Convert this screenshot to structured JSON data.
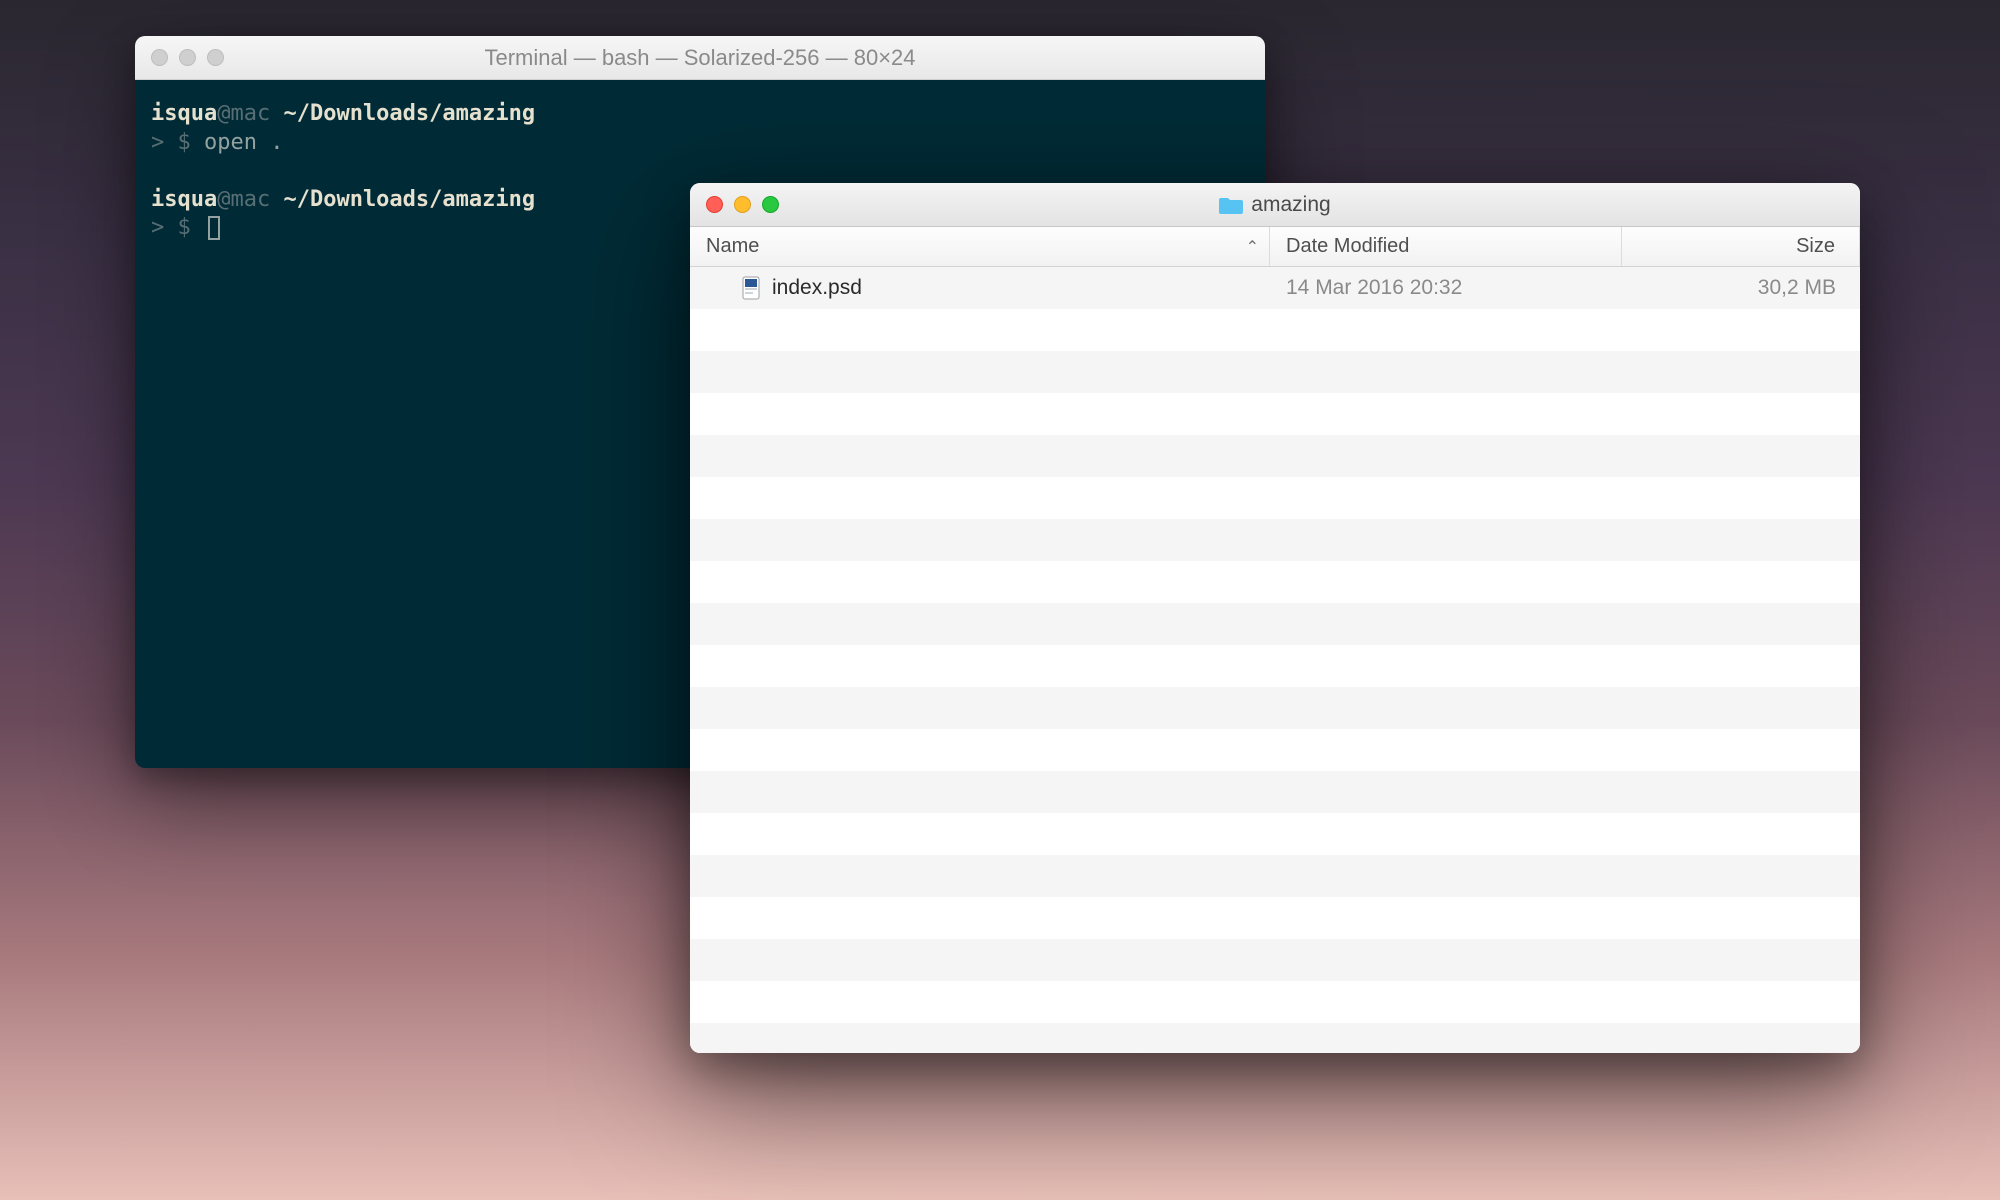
{
  "terminal": {
    "title": "Terminal — bash — Solarized-256 — 80×24",
    "lines": [
      {
        "user": "isqua",
        "at": "@",
        "host": "mac ",
        "path": "~/Downloads/amazing"
      },
      {
        "prompt": "> $ ",
        "cmd": "open ."
      }
    ],
    "lines2": [
      {
        "user": "isqua",
        "at": "@",
        "host": "mac ",
        "path": "~/Downloads/amazing"
      },
      {
        "prompt": "> $ "
      }
    ]
  },
  "finder": {
    "title": "amazing",
    "columns": {
      "name": "Name",
      "date": "Date Modified",
      "size": "Size"
    },
    "files": [
      {
        "name": "index.psd",
        "date": "14 Mar 2016 20:32",
        "size": "30,2 MB"
      }
    ]
  }
}
